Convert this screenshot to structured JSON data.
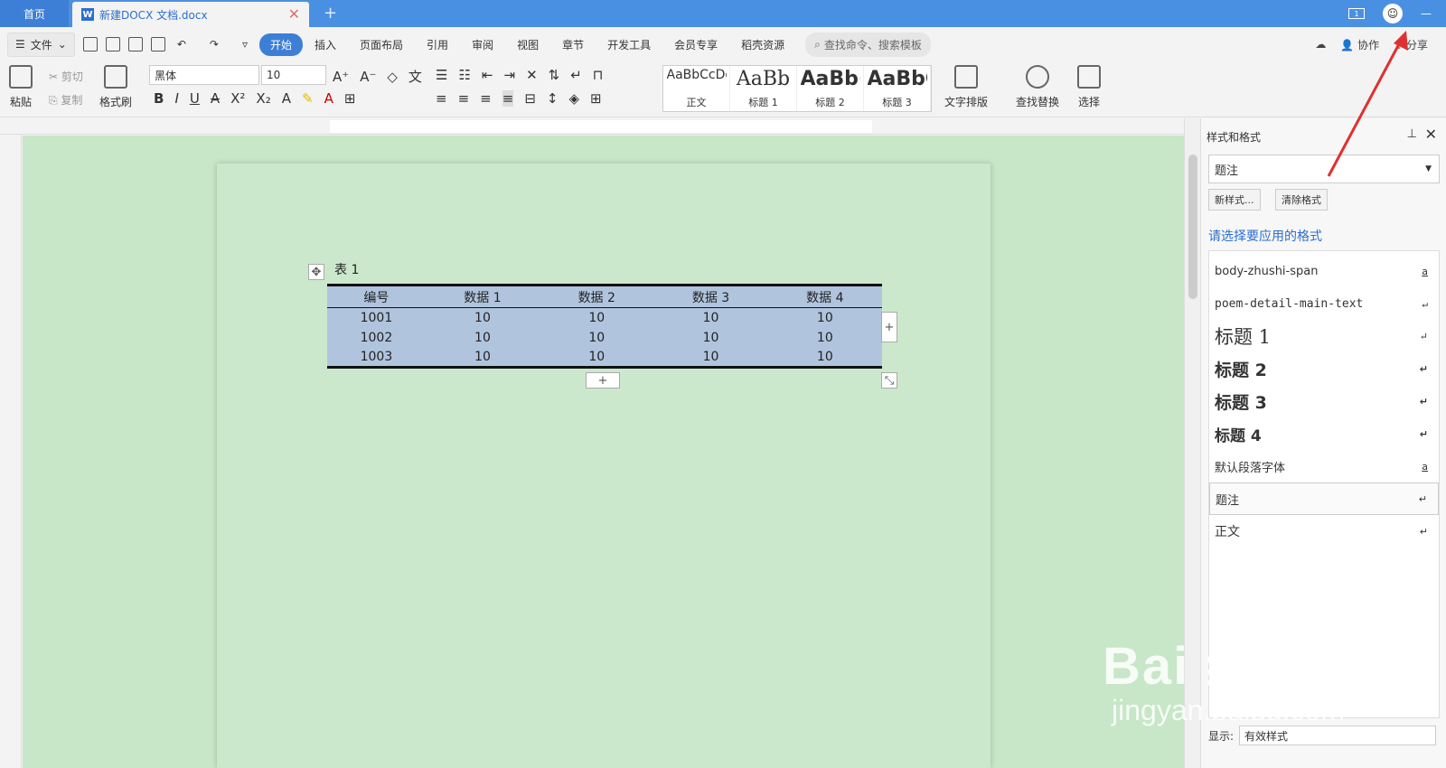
{
  "tabs": {
    "home": "首页",
    "doc": "新建DOCX 文档.docx"
  },
  "menu": {
    "file": "文件",
    "items": [
      "开始",
      "插入",
      "页面布局",
      "引用",
      "审阅",
      "视图",
      "章节",
      "开发工具",
      "会员专享",
      "稻壳资源"
    ],
    "search": "查找命令、搜索模板",
    "right": {
      "collab": "协作",
      "share": "分享"
    }
  },
  "ribbon": {
    "paste": "粘贴",
    "cut": "剪切",
    "copy": "复制",
    "format_painter": "格式刷",
    "font": "黑体",
    "size": "10",
    "styles": [
      {
        "preview": "AaBbCcDc",
        "label": "正文"
      },
      {
        "preview": "AaBb",
        "label": "标题 1"
      },
      {
        "preview": "AaBb(",
        "label": "标题 2"
      },
      {
        "preview": "AaBbC",
        "label": "标题 3"
      }
    ],
    "text_layout": "文字排版",
    "find_replace": "查找替换",
    "select": "选择"
  },
  "doc": {
    "caption": "表 1",
    "table": {
      "headers": [
        "编号",
        "数据 1",
        "数据 2",
        "数据 3",
        "数据 4"
      ],
      "rows": [
        [
          "1001",
          "10",
          "10",
          "10",
          "10"
        ],
        [
          "1002",
          "10",
          "10",
          "10",
          "10"
        ],
        [
          "1003",
          "10",
          "10",
          "10",
          "10"
        ]
      ]
    }
  },
  "panel": {
    "title": "样式和格式",
    "current": "题注",
    "new_style": "新样式...",
    "clear": "清除格式",
    "prompt": "请选择要应用的格式",
    "styles": [
      {
        "name": "body-zhushi-span",
        "mark": "a"
      },
      {
        "name": "poem-detail-main-text",
        "mark": "↵"
      },
      {
        "name": "标题 1",
        "mark": "↵"
      },
      {
        "name": "标题 2",
        "mark": "↵"
      },
      {
        "name": "标题 3",
        "mark": "↵"
      },
      {
        "name": "标题 4",
        "mark": "↵"
      },
      {
        "name": "默认段落字体",
        "mark": "a"
      },
      {
        "name": "题注",
        "mark": "↵"
      },
      {
        "name": "正文",
        "mark": "↵"
      }
    ],
    "show_label": "显示:",
    "show_value": "有效样式"
  },
  "watermark": {
    "brand": "Bai 经验",
    "url": "jingyan.baidu.com"
  },
  "colors": {
    "accent": "#4a90e2",
    "table_fill": "#b0c4de",
    "page_bg": "#cce8cc",
    "arrow": "#e03030"
  }
}
